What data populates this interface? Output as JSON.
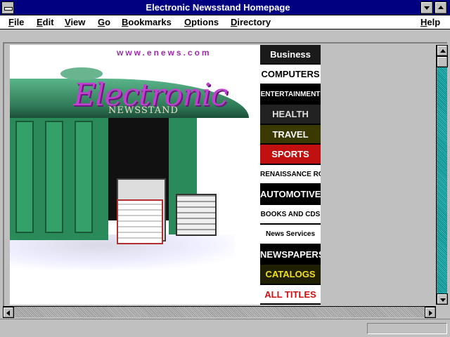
{
  "window": {
    "title": "Electronic Newsstand Homepage"
  },
  "menubar": {
    "items": [
      "File",
      "Edit",
      "View",
      "Go",
      "Bookmarks",
      "Options",
      "Directory"
    ],
    "help": "Help"
  },
  "page": {
    "url_text": "www.enews.com",
    "logo_main": "Electronic",
    "logo_sub": "NEWSSTAND",
    "magazines": [
      {
        "label": "Business",
        "bg": "#1a1a1a",
        "color": "#ffffff"
      },
      {
        "label": "COMPUTERS",
        "bg": "#ffffff",
        "color": "#000000"
      },
      {
        "label": "ENTERTAINMENT",
        "bg": "#000000",
        "color": "#ffffff"
      },
      {
        "label": "HEALTH",
        "bg": "#222222",
        "color": "#dddddd"
      },
      {
        "label": "TRAVEL",
        "bg": "#3a3a00",
        "color": "#ffffff"
      },
      {
        "label": "SPORTS",
        "bg": "#c01010",
        "color": "#ffffff"
      },
      {
        "label": "RENAISSANCE ROOM",
        "bg": "#ffffff",
        "color": "#000000"
      },
      {
        "label": "AUTOMOTIVE",
        "bg": "#000000",
        "color": "#ffffff"
      },
      {
        "label": "BOOKS AND CDS",
        "bg": "#ffffff",
        "color": "#000000"
      },
      {
        "label": "News Services",
        "bg": "#ffffff",
        "color": "#000000"
      },
      {
        "label": "NEWSPAPERS",
        "bg": "#000000",
        "color": "#ffffff"
      },
      {
        "label": "CATALOGS",
        "bg": "#202000",
        "color": "#f0e020"
      },
      {
        "label": "ALL TITLES",
        "bg": "#ffffff",
        "color": "#d01010"
      }
    ]
  },
  "status": {
    "text": ""
  }
}
